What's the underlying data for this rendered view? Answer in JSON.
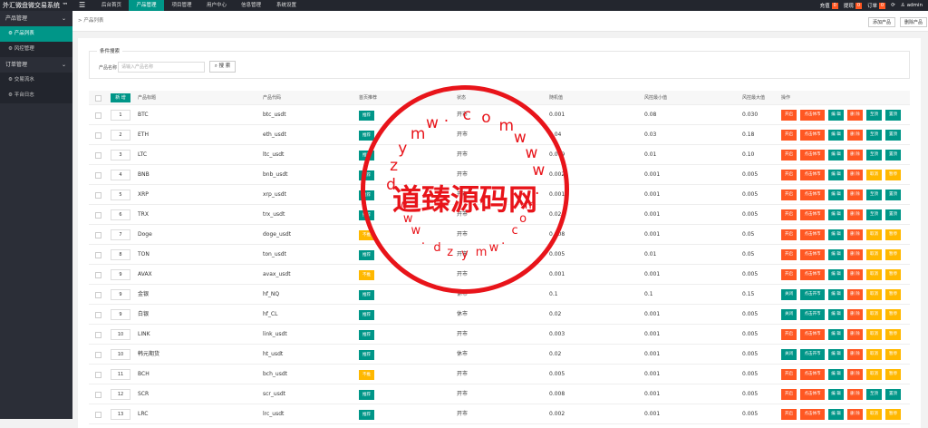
{
  "app": {
    "title": "外汇微盘微交易系统 ™",
    "menu_icon": "hamburger-icon"
  },
  "top_nav": [
    "后台首页",
    "产品管理",
    "项目管理",
    "用户中心",
    "信息管理",
    "系统设置"
  ],
  "top_right": {
    "recharge": "充值",
    "recharge_count": "0",
    "withdraw": "提现",
    "withdraw_count": "0",
    "orders": "订单",
    "orders_count": "0",
    "user": "admin"
  },
  "sidebar": {
    "group1": "产品管理",
    "item1": "产品列表",
    "item2": "风控管理",
    "group2": "订单管理",
    "item3": "交易流水",
    "item4": "平台日志"
  },
  "breadcrumb": "产品列表",
  "toolbar": {
    "add": "添加产品",
    "delete": "删除产品"
  },
  "filter": {
    "title": "条件搜索",
    "label": "产品名称",
    "placeholder": "请输入产品名称",
    "search": "搜 索"
  },
  "table": {
    "new_label": "新 增",
    "headers": [
      "产品标题",
      "产品代码",
      "首页推荐",
      "状态",
      "随机值",
      "风控最小值",
      "风控最大值",
      "操作"
    ],
    "tags": {
      "rec": "推荐",
      "not": "不推"
    },
    "actions": [
      "开启",
      "关闭",
      "点击休市",
      "点击开市",
      "编 辑",
      "删 除",
      "至顶",
      "置顶",
      "取消",
      "暂停"
    ],
    "rows": [
      {
        "id": "1",
        "name": "BTC",
        "code": "btc_usdt",
        "rec": "推荐",
        "status": "开市",
        "rand": "0.001",
        "min": "0.08",
        "max": "0.030",
        "a1": "开启",
        "a2": "点击休市",
        "a5": "至顶",
        "a6": "置顶"
      },
      {
        "id": "2",
        "name": "ETH",
        "code": "eth_usdt",
        "rec": "推荐",
        "status": "开市",
        "rand": "0.04",
        "min": "0.03",
        "max": "0.18",
        "a1": "开启",
        "a2": "点击休市",
        "a5": "至顶",
        "a6": "置顶"
      },
      {
        "id": "3",
        "name": "LTC",
        "code": "ltc_usdt",
        "rec": "推荐",
        "status": "开市",
        "rand": "0.009",
        "min": "0.01",
        "max": "0.10",
        "a1": "开启",
        "a2": "点击休市",
        "a5": "至顶",
        "a6": "置顶"
      },
      {
        "id": "4",
        "name": "BNB",
        "code": "bnb_usdt",
        "rec": "推荐",
        "status": "开市",
        "rand": "0.002",
        "min": "0.001",
        "max": "0.005",
        "a1": "开启",
        "a2": "点击休市",
        "a5": "取消",
        "a6": "暂停"
      },
      {
        "id": "5",
        "name": "XRP",
        "code": "xrp_usdt",
        "rec": "推荐",
        "status": "开市",
        "rand": "0.001",
        "min": "0.001",
        "max": "0.005",
        "a1": "开启",
        "a2": "点击休市",
        "a5": "至顶",
        "a6": "置顶"
      },
      {
        "id": "6",
        "name": "TRX",
        "code": "trx_usdt",
        "rec": "推荐",
        "status": "开市",
        "rand": "0.02",
        "min": "0.001",
        "max": "0.005",
        "a1": "开启",
        "a2": "点击休市",
        "a5": "至顶",
        "a6": "置顶"
      },
      {
        "id": "7",
        "name": "Doge",
        "code": "doge_usdt",
        "rec": "不推",
        "status": "开市",
        "rand": "0.008",
        "min": "0.001",
        "max": "0.05",
        "a1": "开启",
        "a2": "点击休市",
        "a5": "取消",
        "a6": "暂停"
      },
      {
        "id": "8",
        "name": "TON",
        "code": "ton_usdt",
        "rec": "推荐",
        "status": "开市",
        "rand": "0.005",
        "min": "0.01",
        "max": "0.05",
        "a1": "开启",
        "a2": "点击休市",
        "a5": "取消",
        "a6": "暂停"
      },
      {
        "id": "9",
        "name": "AVAX",
        "code": "avax_usdt",
        "rec": "不推",
        "status": "开市",
        "rand": "0.001",
        "min": "0.001",
        "max": "0.005",
        "a1": "开启",
        "a2": "点击休市",
        "a5": "取消",
        "a6": "暂停"
      },
      {
        "id": "9",
        "name": "金银",
        "code": "hf_NQ",
        "rec": "推荐",
        "status": "休市",
        "rand": "0.1",
        "min": "0.1",
        "max": "0.15",
        "a1": "关闭",
        "a2": "点击开市",
        "a5": "取消",
        "a6": "暂停"
      },
      {
        "id": "9",
        "name": "白银",
        "code": "hf_CL",
        "rec": "推荐",
        "status": "休市",
        "rand": "0.02",
        "min": "0.001",
        "max": "0.005",
        "a1": "关闭",
        "a2": "点击开市",
        "a5": "取消",
        "a6": "暂停"
      },
      {
        "id": "10",
        "name": "LINK",
        "code": "link_usdt",
        "rec": "推荐",
        "status": "开市",
        "rand": "0.003",
        "min": "0.001",
        "max": "0.005",
        "a1": "开启",
        "a2": "点击休市",
        "a5": "取消",
        "a6": "暂停"
      },
      {
        "id": "10",
        "name": "韩元期货",
        "code": "ht_usdt",
        "rec": "推荐",
        "status": "休市",
        "rand": "0.02",
        "min": "0.001",
        "max": "0.005",
        "a1": "关闭",
        "a2": "点击开市",
        "a5": "取消",
        "a6": "暂停"
      },
      {
        "id": "11",
        "name": "BCH",
        "code": "bch_usdt",
        "rec": "不推",
        "status": "开市",
        "rand": "0.005",
        "min": "0.001",
        "max": "0.005",
        "a1": "开启",
        "a2": "点击休市",
        "a5": "取消",
        "a6": "暂停"
      },
      {
        "id": "12",
        "name": "SCR",
        "code": "scr_usdt",
        "rec": "推荐",
        "status": "开市",
        "rand": "0.008",
        "min": "0.001",
        "max": "0.005",
        "a1": "开启",
        "a2": "点击休市",
        "a5": "至顶",
        "a6": "置顶"
      },
      {
        "id": "13",
        "name": "LRC",
        "code": "lrc_usdt",
        "rec": "推荐",
        "status": "开市",
        "rand": "0.002",
        "min": "0.001",
        "max": "0.005",
        "a1": "开启",
        "a2": "点击休市",
        "a5": "取消",
        "a6": "暂停"
      }
    ]
  },
  "watermark": {
    "center": "道臻源码网",
    "ring_top": [
      "d",
      "z",
      "y",
      "m",
      "w",
      ".",
      "c",
      "o",
      "m",
      "w",
      "w",
      "w",
      "."
    ],
    "ring_bottom": [
      "w",
      "w",
      "w",
      ".",
      "d",
      "z",
      "y",
      "m",
      "w",
      ".",
      "c",
      "o",
      "m"
    ]
  },
  "colors": {
    "teal": "#009688",
    "orange": "#ff5722",
    "yellow": "#ffb800",
    "red": "#e8141a"
  }
}
